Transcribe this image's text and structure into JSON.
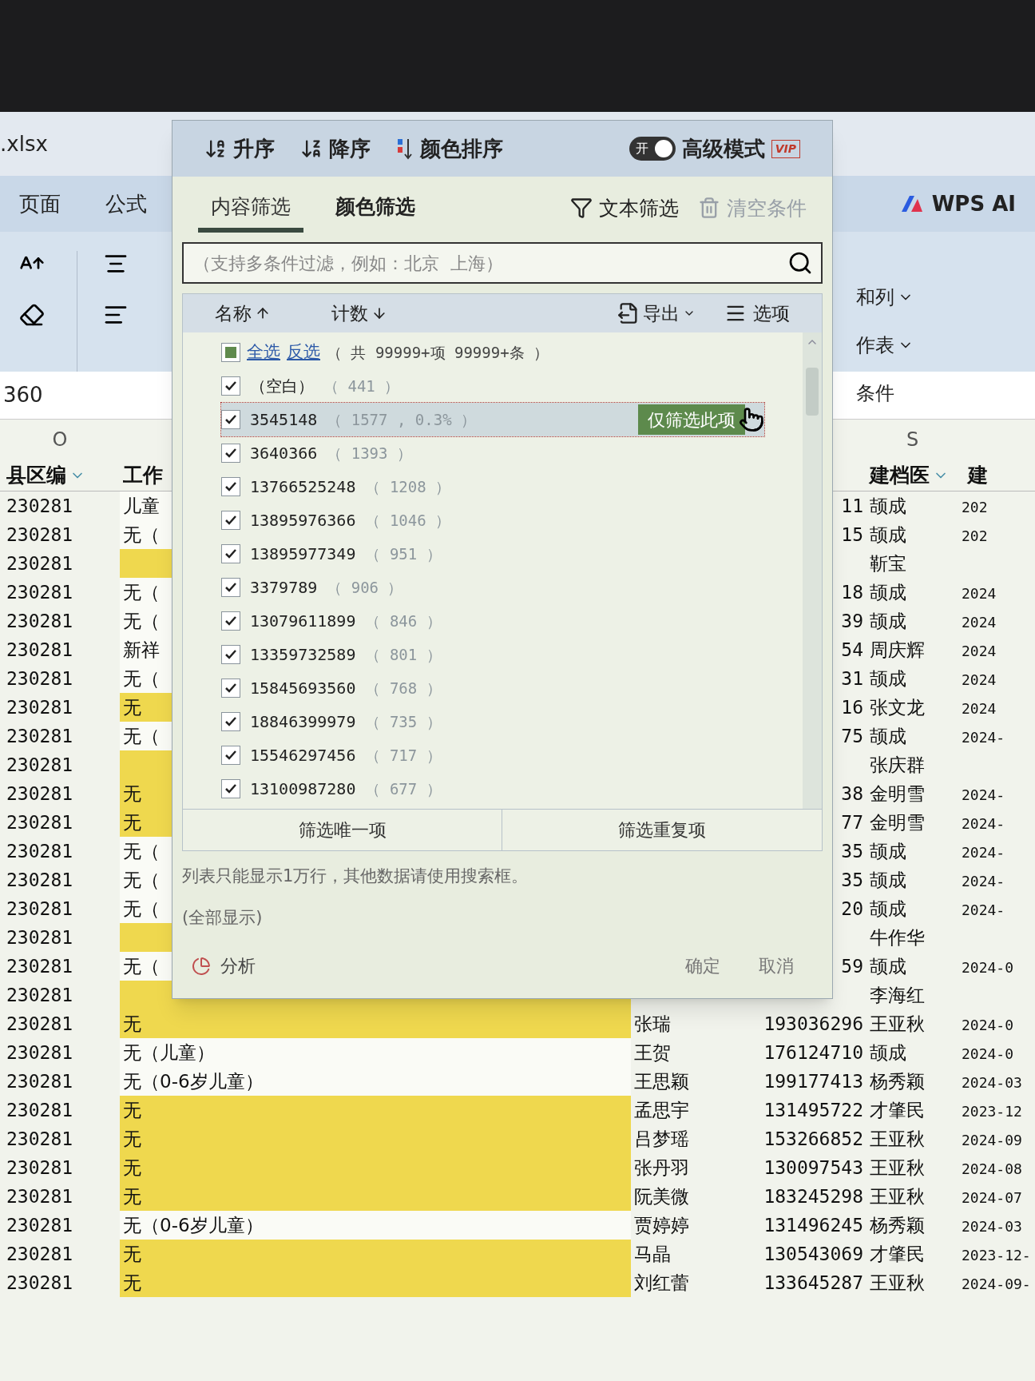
{
  "window": {
    "file_name": ".xlsx"
  },
  "ribbon": {
    "tabs": [
      "页面",
      "公式"
    ],
    "wps_ai": "WPS AI",
    "right_items": [
      {
        "label": "和列",
        "dropdown": true
      },
      {
        "label": "作表",
        "dropdown": true
      },
      {
        "label": "条件",
        "dropdown": false
      }
    ]
  },
  "name_box": "360",
  "column_letters": [
    "O",
    "S"
  ],
  "headers": {
    "column_1": "县区编",
    "column_2": "工作",
    "column_5": "建档医",
    "column_6": "建"
  },
  "rows": [
    {
      "area": "230281",
      "work": "儿童",
      "highlighted": false,
      "phone": "11",
      "doctor": "颉成",
      "date": "202"
    },
    {
      "area": "230281",
      "work": "无（",
      "highlighted": false,
      "phone": "15",
      "doctor": "颉成",
      "date": "202"
    },
    {
      "area": "230281",
      "highlighted": true,
      "doctor": "靳宝"
    },
    {
      "area": "230281",
      "work": "无（",
      "highlighted": false,
      "phone": "18",
      "doctor": "颉成",
      "date": "2024"
    },
    {
      "area": "230281",
      "work": "无（",
      "highlighted": false,
      "phone": "39",
      "doctor": "颉成",
      "date": "2024"
    },
    {
      "area": "230281",
      "work": "新祥",
      "highlighted": false,
      "phone": "54",
      "doctor": "周庆辉",
      "date": "2024"
    },
    {
      "area": "230281",
      "work": "无（",
      "highlighted": false,
      "phone": "31",
      "doctor": "颉成",
      "date": "2024"
    },
    {
      "area": "230281",
      "work": "无",
      "highlighted": true,
      "phone": "16",
      "doctor": "张文龙",
      "date": "2024"
    },
    {
      "area": "230281",
      "work": "无（",
      "highlighted": false,
      "phone": "75",
      "doctor": "颉成",
      "date": "2024-"
    },
    {
      "area": "230281",
      "highlighted": true,
      "doctor": "张庆群"
    },
    {
      "area": "230281",
      "work": "无",
      "highlighted": true,
      "phone": "38",
      "doctor": "金明雪",
      "date": "2024-"
    },
    {
      "area": "230281",
      "work": "无",
      "highlighted": true,
      "phone": "77",
      "doctor": "金明雪",
      "date": "2024-"
    },
    {
      "area": "230281",
      "work": "无（",
      "highlighted": false,
      "phone": "35",
      "doctor": "颉成",
      "date": "2024-"
    },
    {
      "area": "230281",
      "work": "无（",
      "highlighted": false,
      "phone": "35",
      "doctor": "颉成",
      "date": "2024-"
    },
    {
      "area": "230281",
      "work": "无（",
      "highlighted": false,
      "phone": "20",
      "doctor": "颉成",
      "date": "2024-"
    },
    {
      "area": "230281",
      "highlighted": true,
      "doctor": "牛作华"
    },
    {
      "area": "230281",
      "work": "无（",
      "highlighted": false,
      "phone": "59",
      "doctor": "颉成",
      "date": "2024-0"
    },
    {
      "area": "230281",
      "highlighted": true,
      "doctor": "李海红"
    },
    {
      "area": "230281",
      "work": "无",
      "highlighted": true,
      "name": "张瑞",
      "phone": "193036296",
      "doctor": "王亚秋",
      "date": "2024-0"
    },
    {
      "area": "230281",
      "work": "无（儿童）",
      "highlighted": false,
      "name": "王贺",
      "phone": "176124710",
      "doctor": "颉成",
      "date": "2024-0"
    },
    {
      "area": "230281",
      "work": "无（0-6岁儿童）",
      "highlighted": false,
      "name": "王思颖",
      "phone": "199177413",
      "doctor": "杨秀颖",
      "date": "2024-03"
    },
    {
      "area": "230281",
      "work": "无",
      "highlighted": true,
      "name": "孟思宇",
      "phone": "131495722",
      "doctor": "才肇民",
      "date": "2023-12"
    },
    {
      "area": "230281",
      "work": "无",
      "highlighted": true,
      "name": "吕梦瑶",
      "phone": "153266852",
      "doctor": "王亚秋",
      "date": "2024-09"
    },
    {
      "area": "230281",
      "work": "无",
      "highlighted": true,
      "name": "张丹羽",
      "phone": "130097543",
      "doctor": "王亚秋",
      "date": "2024-08"
    },
    {
      "area": "230281",
      "work": "无",
      "highlighted": true,
      "name": "阮美微",
      "phone": "183245298",
      "doctor": "王亚秋",
      "date": "2024-07"
    },
    {
      "area": "230281",
      "work": "无（0-6岁儿童）",
      "highlighted": false,
      "name": "贾婷婷",
      "phone": "131496245",
      "doctor": "杨秀颖",
      "date": "2024-03"
    },
    {
      "area": "230281",
      "work": "无",
      "highlighted": true,
      "name": "马晶",
      "phone": "130543069",
      "doctor": "才肇民",
      "date": "2023-12-"
    },
    {
      "area": "230281",
      "work": "无",
      "highlighted": true,
      "name": "刘红蕾",
      "phone": "133645287",
      "doctor": "王亚秋",
      "date": "2024-09-"
    }
  ],
  "filter_popup": {
    "sort_buttons": [
      {
        "kind": "ascending",
        "label": "升序"
      },
      {
        "kind": "descending",
        "label": "降序"
      },
      {
        "kind": "color",
        "label": "颜色排序"
      }
    ],
    "advanced_mode": {
      "switch_text": "开",
      "on": true,
      "label": "高级模式",
      "badge": "VIP"
    },
    "tabs": [
      {
        "label": "内容筛选",
        "selected": true
      },
      {
        "label": "颜色筛选",
        "selected": false
      }
    ],
    "text_filter": "文本筛选",
    "clear_conditions": "清空条件",
    "search": {
      "placeholder": "（支持多条件过滤，例如：北京  上海）"
    },
    "list_header": {
      "name_sort": "名称",
      "count_sort": "计数",
      "export": "导出",
      "options": "选项"
    },
    "select_all": {
      "indeterminate": true,
      "select_all": "全选",
      "invert": "反选",
      "summary": "（ 共 99999+项 99999+条 ）"
    },
    "items": [
      {
        "value": "（空白）",
        "count": "（ 441 ）",
        "checked": true,
        "selected": false
      },
      {
        "value": "3545148",
        "count": "（ 1577 , 0.3% ）",
        "checked": true,
        "selected": true
      },
      {
        "value": "3640366",
        "count": "（ 1393 ）",
        "checked": true,
        "selected": false
      },
      {
        "value": "13766525248",
        "count": "（ 1208 ）",
        "checked": true,
        "selected": false
      },
      {
        "value": "13895976366",
        "count": "（ 1046 ）",
        "checked": true,
        "selected": false
      },
      {
        "value": "13895977349",
        "count": "（ 951 ）",
        "checked": true,
        "selected": false
      },
      {
        "value": "3379789",
        "count": "（ 906 ）",
        "checked": true,
        "selected": false
      },
      {
        "value": "13079611899",
        "count": "（ 846 ）",
        "checked": true,
        "selected": false
      },
      {
        "value": "13359732589",
        "count": "（ 801 ）",
        "checked": true,
        "selected": false
      },
      {
        "value": "15845693560",
        "count": "（ 768 ）",
        "checked": true,
        "selected": false
      },
      {
        "value": "18846399979",
        "count": "（ 735 ）",
        "checked": true,
        "selected": false
      },
      {
        "value": "15546297456",
        "count": "（ 717 ）",
        "checked": true,
        "selected": false
      },
      {
        "value": "13100987280",
        "count": "（ 677 ）",
        "checked": true,
        "selected": false
      }
    ],
    "hover_action": "仅筛选此项",
    "unique_button": "筛选唯一项",
    "duplicate_button": "筛选重复项",
    "note": "列表只能显示1万行，其他数据请使用搜索框。",
    "show_all": "(全部显示)",
    "analysis": "分析",
    "ok": "确定",
    "cancel": "取消"
  }
}
